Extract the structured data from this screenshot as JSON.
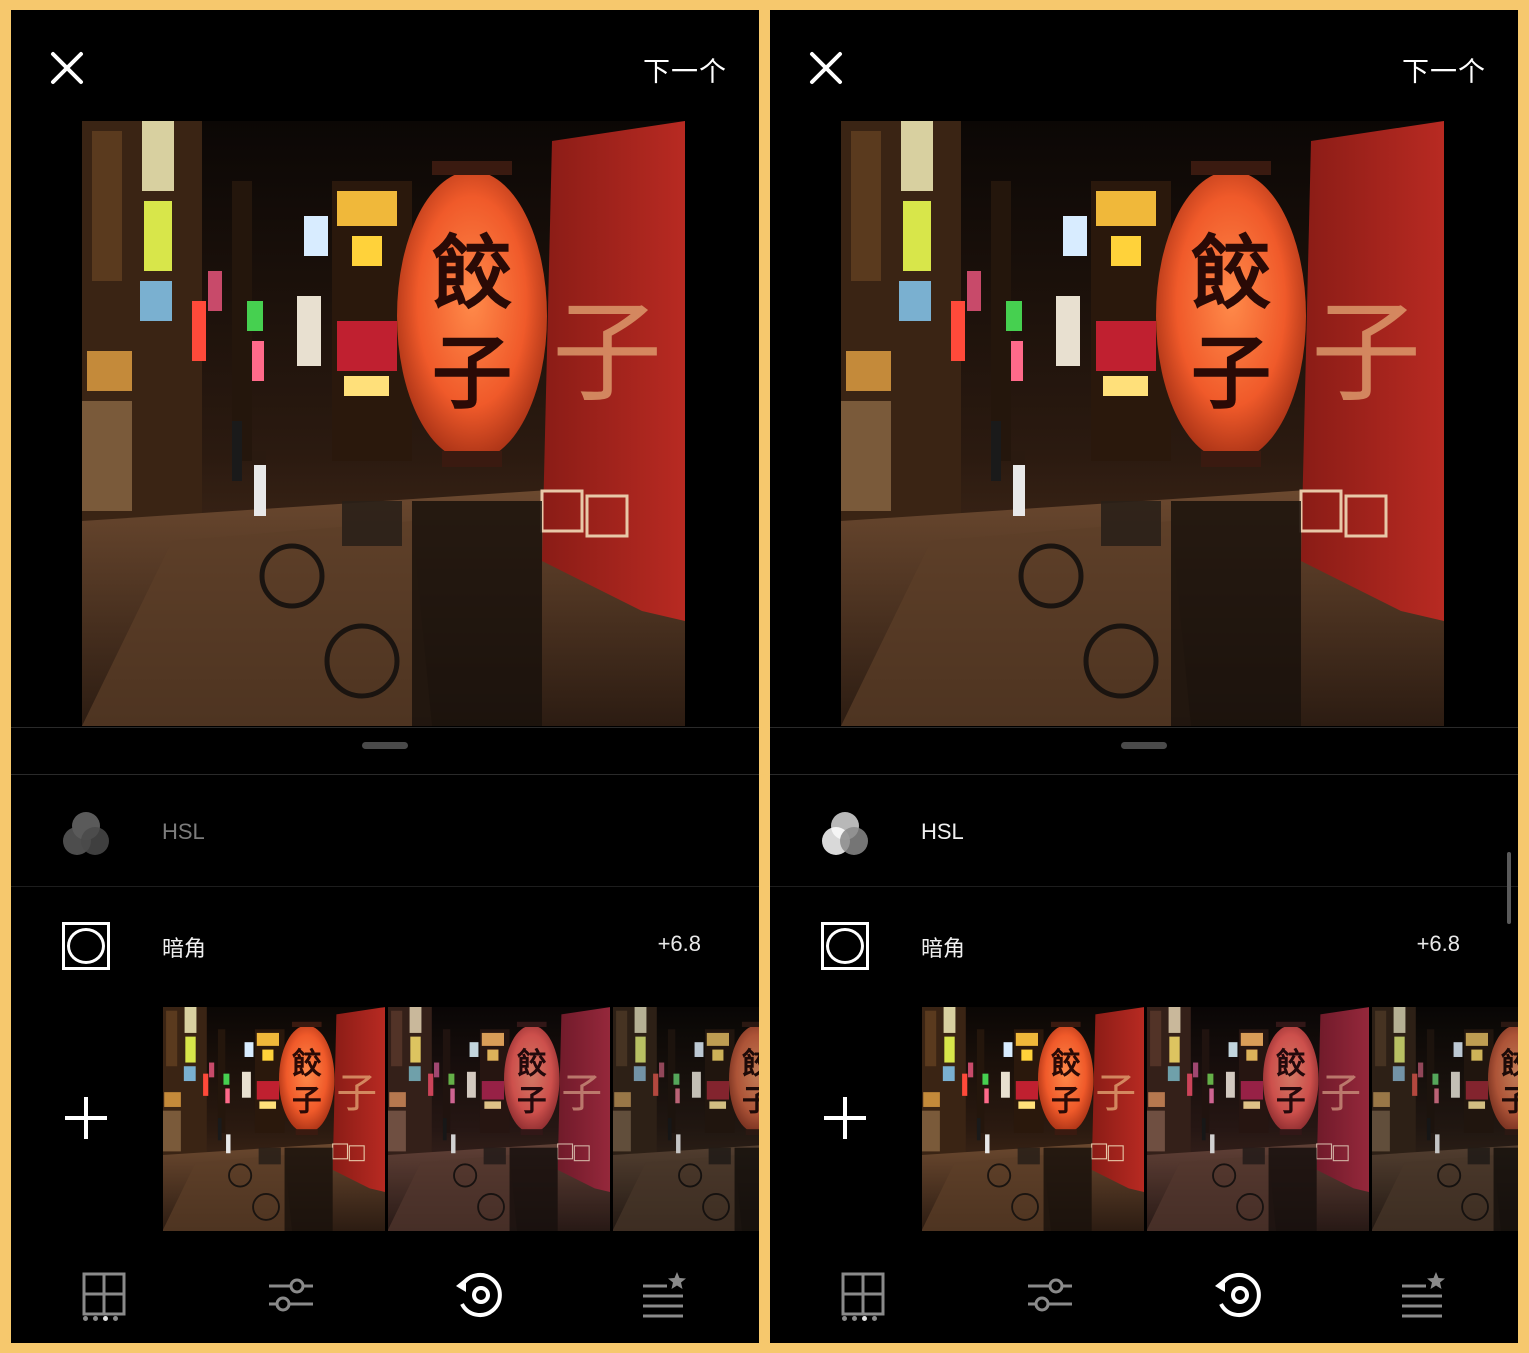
{
  "screens": [
    {
      "id": "left",
      "header": {
        "next_label": "下一个"
      },
      "tools": {
        "hsl": {
          "label": "HSL",
          "state": "dimmed"
        },
        "vignette": {
          "label": "暗角",
          "value": "+6.8"
        }
      },
      "nav": {
        "active": "history",
        "page_dots_active_index": 2
      }
    },
    {
      "id": "right",
      "header": {
        "next_label": "下一个"
      },
      "tools": {
        "hsl": {
          "label": "HSL",
          "state": "active"
        },
        "vignette": {
          "label": "暗角",
          "value": "+6.8"
        }
      },
      "nav": {
        "active": "history",
        "page_dots_active_index": 2
      },
      "scroll_indicator": true
    }
  ],
  "icons": {
    "close": "close-icon",
    "hsl": "hsl-circles-icon",
    "vignette": "vignette-icon",
    "add": "plus-icon",
    "grid": "grid-icon",
    "adjust": "sliders-icon",
    "history": "history-icon",
    "presets": "presets-star-icon"
  },
  "colors": {
    "frame": "#f6c86d",
    "background": "#000000",
    "lantern": "#e8532a",
    "banner": "#a5221c"
  }
}
